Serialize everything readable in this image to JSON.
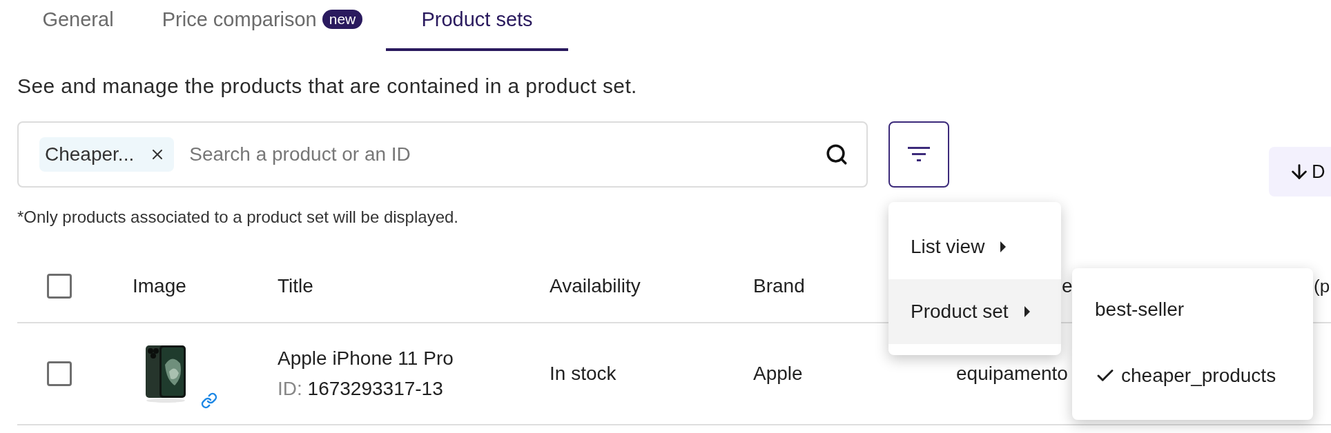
{
  "tabs": [
    {
      "label": "General",
      "selected": false
    },
    {
      "label": "Price comparison",
      "badge": "new",
      "selected": false
    },
    {
      "label": "Product sets",
      "selected": true
    }
  ],
  "description": "See and manage the products that are contained in a product set.",
  "search": {
    "chip": "Cheaper...",
    "placeholder": "Search a product or an ID"
  },
  "note": "*Only products associated to a product set will be displayed.",
  "download_button": {
    "label": "D"
  },
  "table": {
    "columns": [
      "Image",
      "Title",
      "Availability",
      "Brand",
      "e",
      "(p"
    ],
    "header_checked": false,
    "rows": [
      {
        "checked": false,
        "kind": "picture",
        "title": "Apple iPhone 11 Pro",
        "id_label": "ID:",
        "id": "1673293317-13",
        "availability": "In stock",
        "brand": "Apple",
        "column_6": "equipamento"
      }
    ]
  },
  "filter_menu": {
    "items": [
      {
        "label": "List view",
        "selected": false
      },
      {
        "label": "Product set",
        "selected": true
      }
    ],
    "submenu": [
      {
        "label": "best-seller",
        "selected": false
      },
      {
        "label": "cheaper_products",
        "selected": true
      }
    ]
  }
}
